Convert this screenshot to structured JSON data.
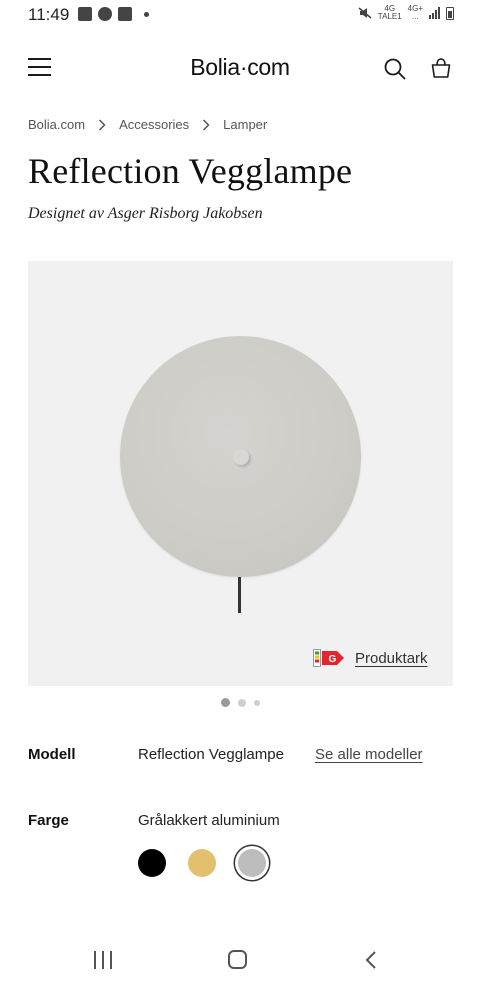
{
  "status": {
    "time": "11:49",
    "net1_top": "4G",
    "net1_bottom": "TALE1",
    "net2_top": "4G+",
    "net2_bottom": "..."
  },
  "header": {
    "brand": "Bolia·com",
    "menu_icon": "hamburger-menu-icon",
    "search_icon": "search-icon",
    "cart_icon": "shopping-bag-icon"
  },
  "breadcrumb": {
    "items": [
      "Bolia.com",
      "Accessories",
      "Lamper"
    ]
  },
  "product": {
    "title": "Reflection Vegglampe",
    "designer": "Designet av Asger Risborg Jakobsen",
    "datasheet_label": "Produktark",
    "datasheet_badge": "G",
    "image_count": 3,
    "active_image": 1
  },
  "options": {
    "model_label": "Modell",
    "model_value": "Reflection Vegglampe",
    "model_link": "Se alle modeller",
    "color_label": "Farge",
    "color_value": "Grålakkert aluminium",
    "swatches": [
      {
        "name": "black",
        "color": "#000000",
        "selected": false
      },
      {
        "name": "brass",
        "color": "#e3c06e",
        "selected": false
      },
      {
        "name": "grey-lacquered-aluminium",
        "color": "#bdbdbd",
        "selected": true
      }
    ]
  },
  "colors": {
    "image_background": "#f1f1f1",
    "lamp_color": "#cdccc7",
    "badge_red": "#e2262f"
  }
}
